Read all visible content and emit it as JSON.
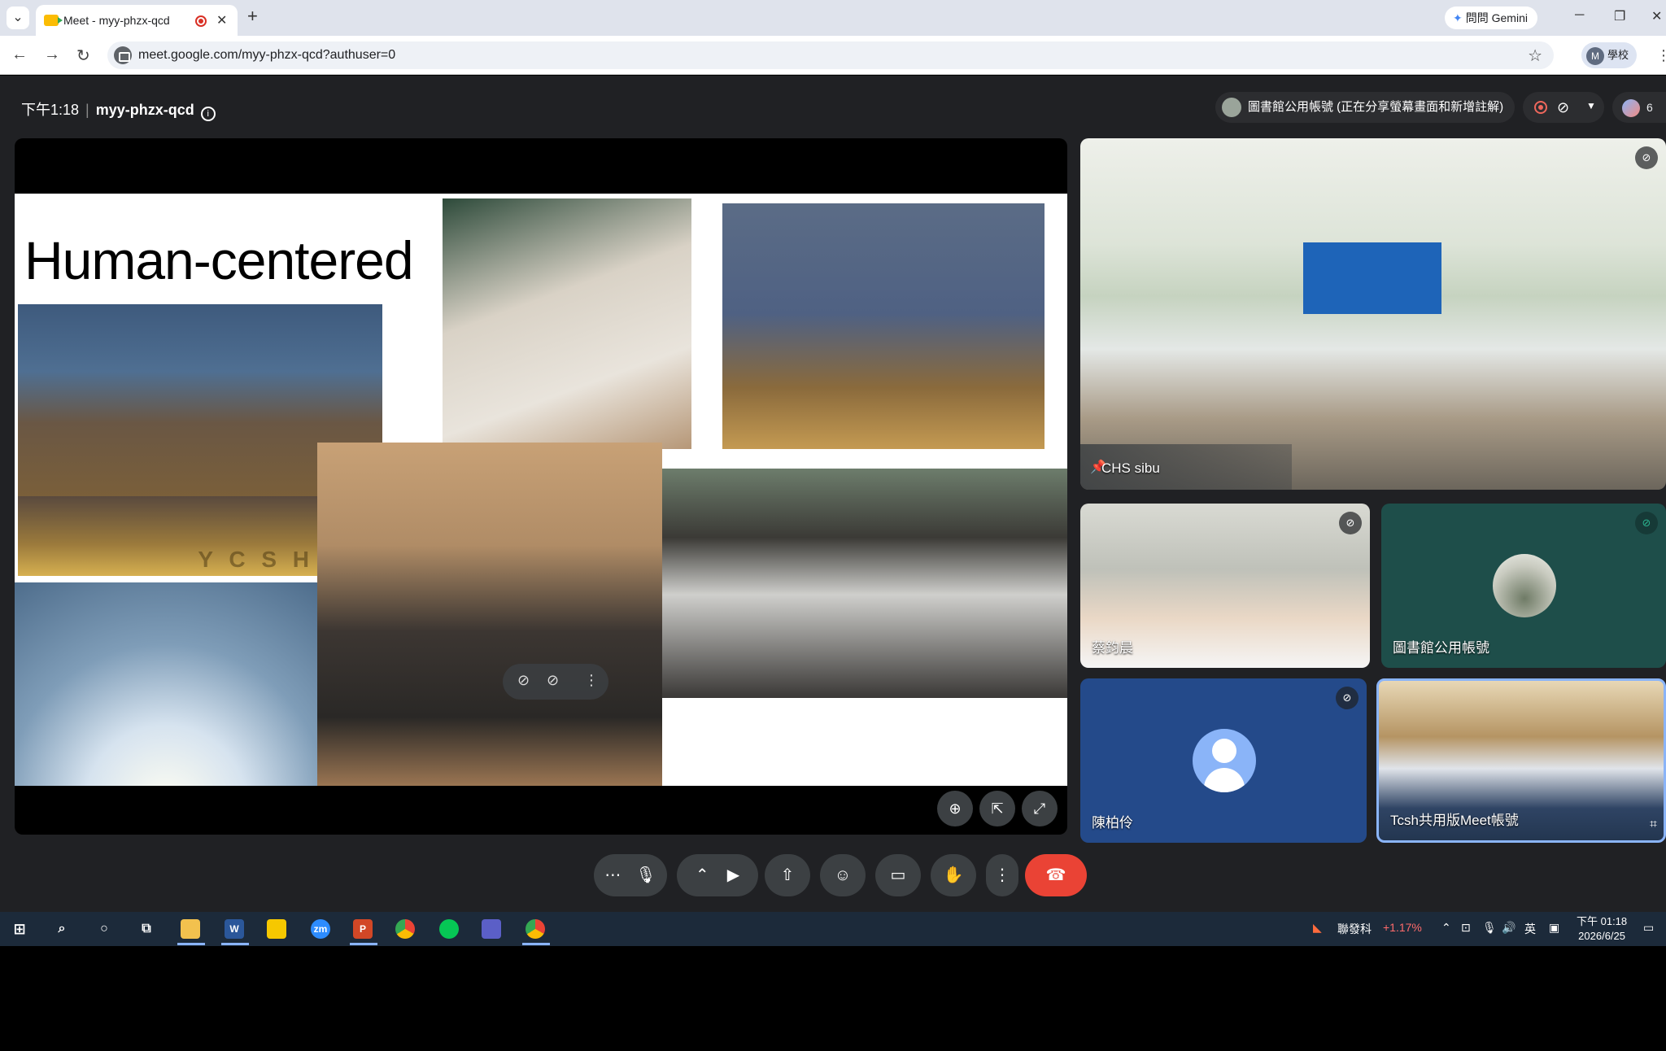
{
  "browser": {
    "tab_title": "Meet - myy-phzx-qcd",
    "gemini_label": "問問 Gemini",
    "url": "meet.google.com/myy-phzx-qcd?authuser=0",
    "profile_initial": "M",
    "profile_label": "學校"
  },
  "meet": {
    "time": "下午1:18",
    "meeting_code": "myy-phzx-qcd",
    "presenter_status": "圖書館公用帳號 (正在分享螢幕畫面和新增註解)",
    "participant_count": "6"
  },
  "slide": {
    "title": "Human-centered",
    "banner_letters": "Y C S H"
  },
  "participants": [
    {
      "name": "CHS sibu",
      "pinned": true,
      "muted": true
    },
    {
      "name": "蔡鈞晨",
      "muted": true
    },
    {
      "name": "圖書館公用帳號",
      "muted": true
    },
    {
      "name": "陳柏伶",
      "muted": true
    },
    {
      "name": "Tcsh共用版Meet帳號",
      "muted": false
    }
  ],
  "taskbar": {
    "stock_name": "聯發科",
    "stock_change": "+1.17%",
    "ime": "英",
    "time": "下午 01:18",
    "date": "2026/6/25"
  },
  "colors": {
    "meet_bg": "#202124",
    "end_call": "#ea4335",
    "accent": "#8ab4f8"
  },
  "icons": [
    "search-icon",
    "mic-icon",
    "camera-icon",
    "present-icon",
    "emoji-icon",
    "captions-icon",
    "hand-icon",
    "more-icon",
    "end-call-icon",
    "chat-icon",
    "apps-icon",
    "host-controls-icon"
  ]
}
